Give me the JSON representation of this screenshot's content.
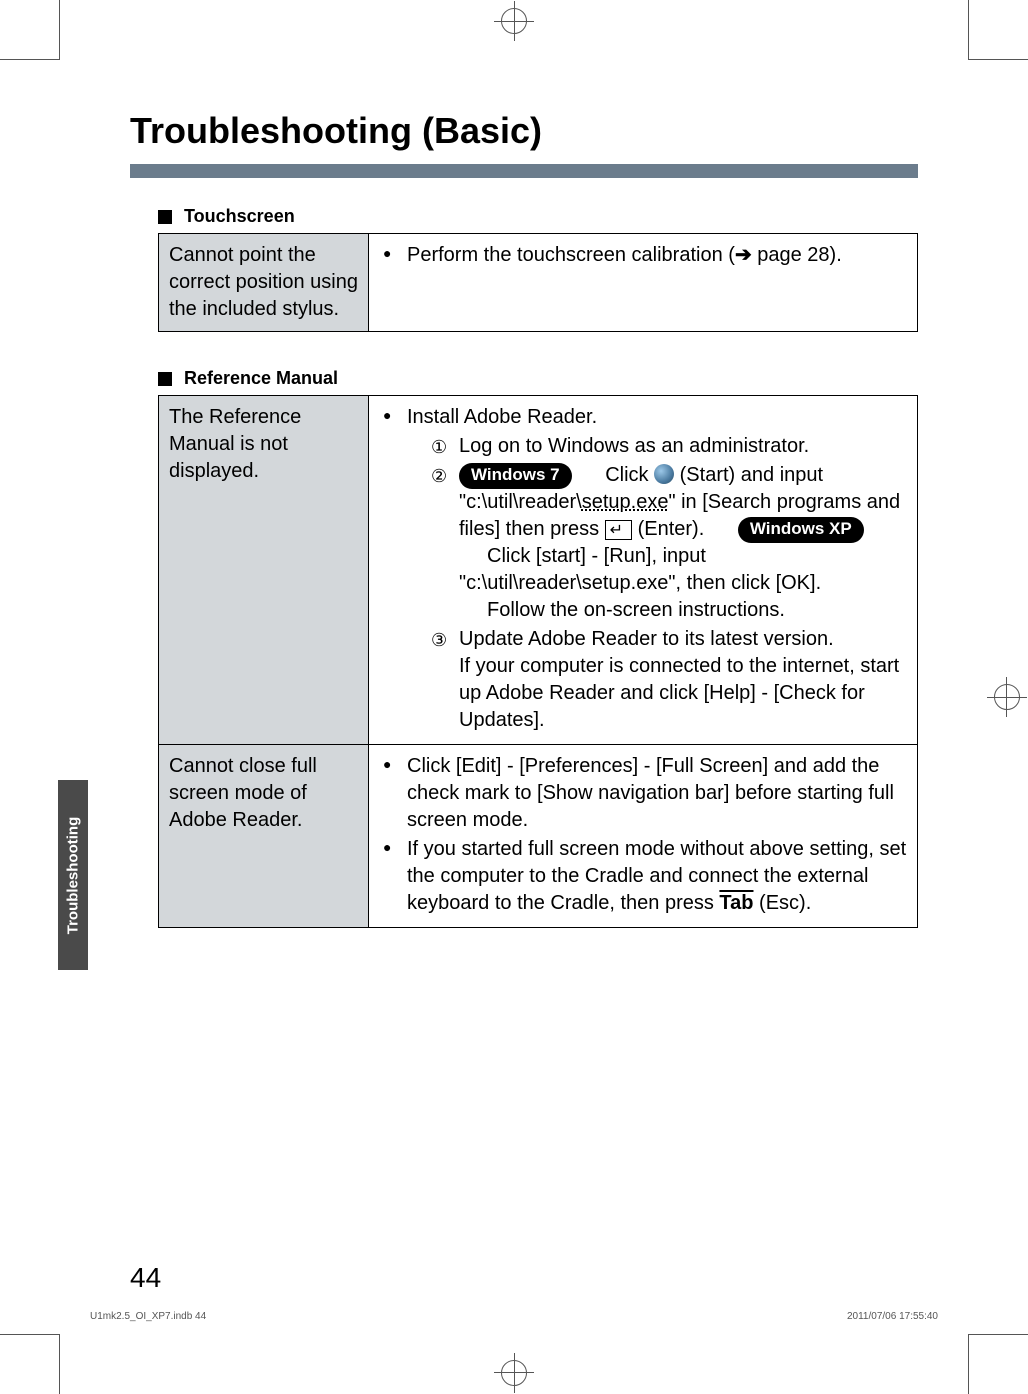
{
  "title": "Troubleshooting (Basic)",
  "sections": {
    "touchscreen": {
      "heading": "Touchscreen",
      "rows": [
        {
          "label": "Cannot point the correct position using the included stylus.",
          "bullets": [
            {
              "text_before": "Perform the touchscreen calibration (",
              "arrow": "➔",
              "text_mid": " page 28).",
              "text_after": ""
            }
          ]
        }
      ]
    },
    "refmanual": {
      "heading": "Reference Manual",
      "rows": [
        {
          "label": "The Reference Manual is not displayed.",
          "content": {
            "lead": "Install Adobe Reader.",
            "step1": "Log on to Windows as an administrator.",
            "win7_pill": "Windows 7",
            "win7_line_a": "Click ",
            "win7_line_b": " (Start) and input \"c:\\util\\reader\\",
            "win7_setup": "setup.exe",
            "win7_line_c": "\" in [Search programs and files] then press ",
            "win7_enter": "↵",
            "win7_line_d": " (Enter).",
            "winxp_pill": "Windows XP",
            "winxp_line": "Click [start] - [Run], input \"c:\\util\\reader\\setup.exe\", then click [OK].",
            "follow": "Follow the on-screen instructions.",
            "step3a": "Update Adobe Reader to its latest version.",
            "step3b": "If your computer is connected to the internet, start up Adobe Reader and click [Help] - [Check for Updates]."
          }
        },
        {
          "label": "Cannot close full screen mode of Adobe Reader.",
          "bullets": [
            "Click [Edit] - [Preferences] - [Full Screen] and add the check mark to [Show navigation bar] before starting full screen mode.",
            "If you started full screen mode without above setting, set the computer to the Cradle and connect the external keyboard to the Cradle, then press "
          ],
          "tab_key": "Tab",
          "tab_suffix": " (Esc)."
        }
      ]
    }
  },
  "sidetab": "Troubleshooting",
  "page_number": "44",
  "footer": {
    "left": "U1mk2.5_OI_XP7.indb   44",
    "right": "2011/07/06   17:55:40"
  }
}
